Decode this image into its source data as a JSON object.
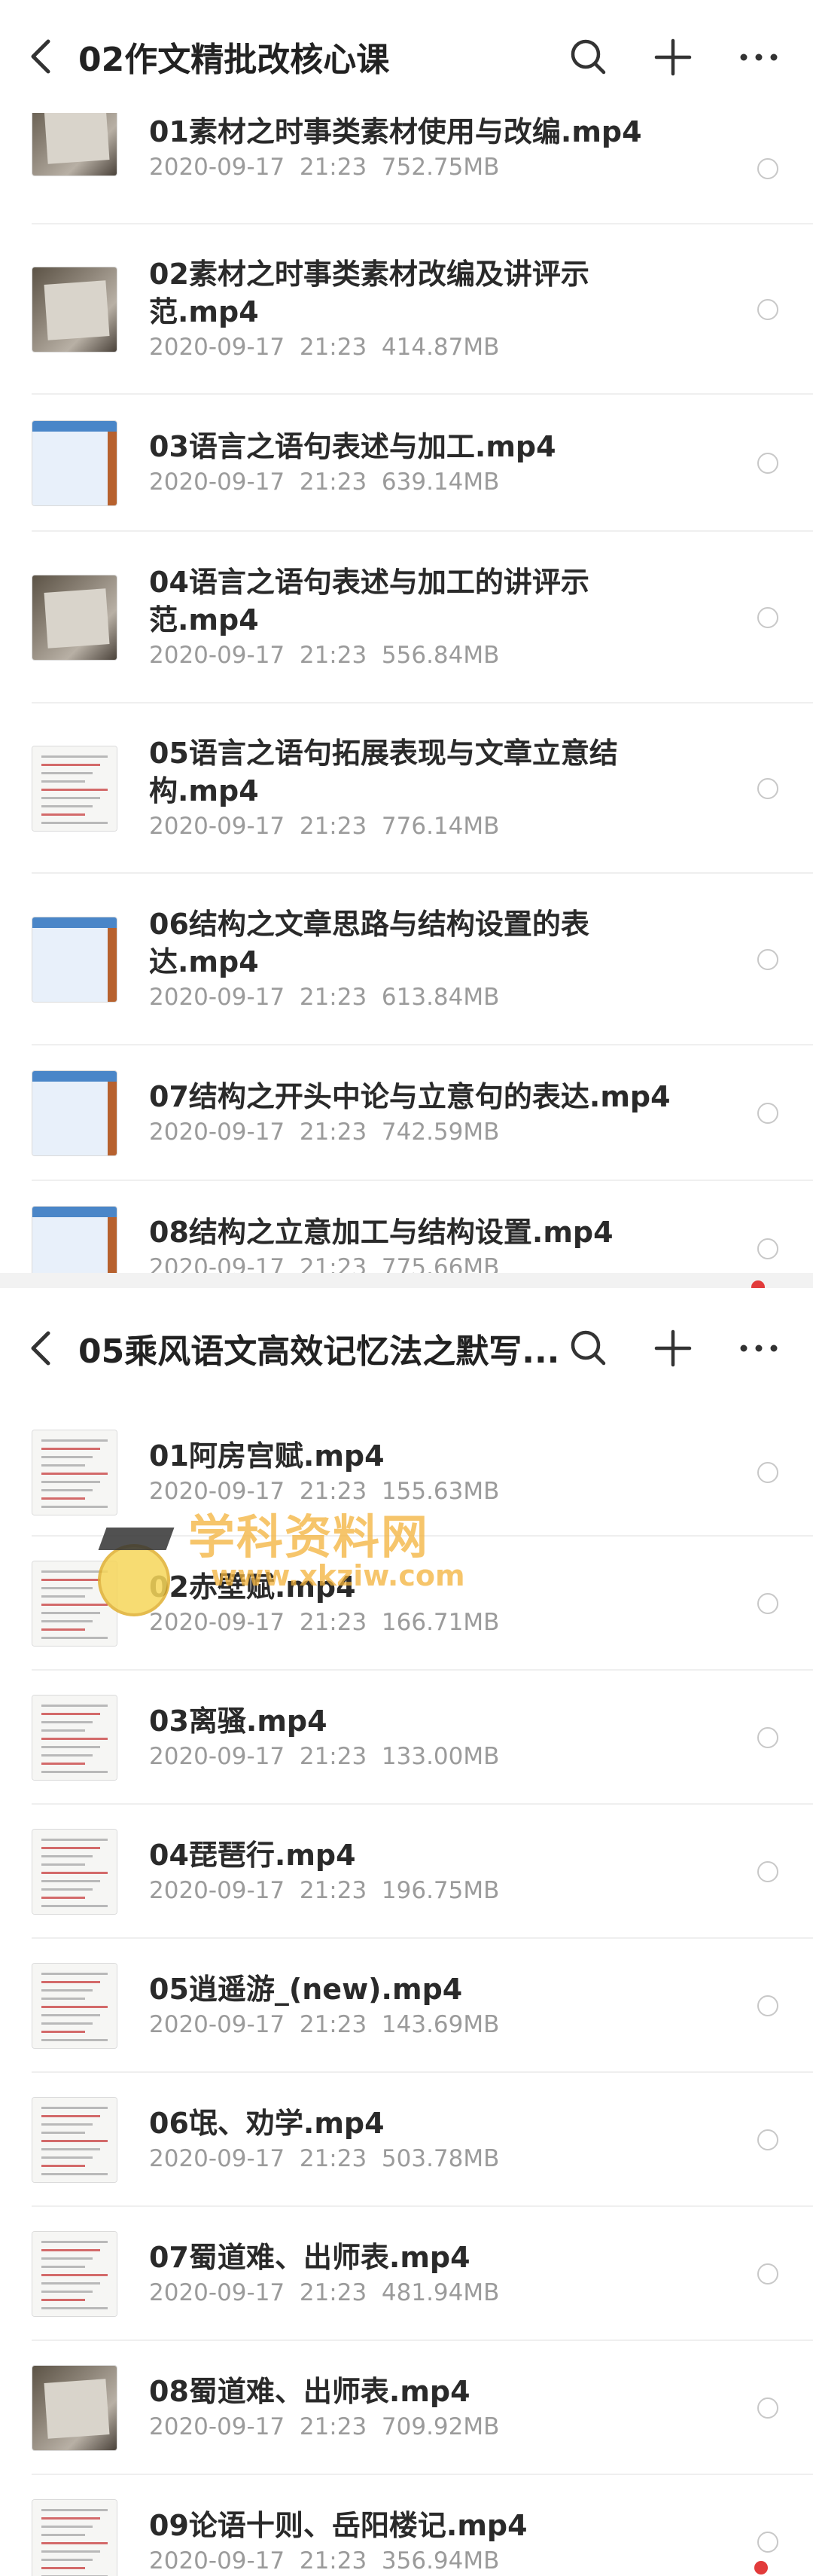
{
  "panel1": {
    "title": "02作文精批改核心课",
    "items": [
      {
        "name": "01素材之时事类素材使用与改编.mp4",
        "meta": "2020-09-17  21:23  752.75MB",
        "thumb": "photo"
      },
      {
        "name": "02素材之时事类素材改编及讲评示范.mp4",
        "meta": "2020-09-17  21:23  414.87MB",
        "thumb": "photo"
      },
      {
        "name": "03语言之语句表述与加工.mp4",
        "meta": "2020-09-17  21:23  639.14MB",
        "thumb": "blue"
      },
      {
        "name": "04语言之语句表述与加工的讲评示范.mp4",
        "meta": "2020-09-17  21:23  556.84MB",
        "thumb": "photo"
      },
      {
        "name": "05语言之语句拓展表现与文章立意结构.mp4",
        "meta": "2020-09-17  21:23  776.14MB",
        "thumb": "doc"
      },
      {
        "name": "06结构之文章思路与结构设置的表达.mp4",
        "meta": "2020-09-17  21:23  613.84MB",
        "thumb": "blue"
      },
      {
        "name": "07结构之开头中论与立意句的表达.mp4",
        "meta": "2020-09-17  21:23  742.59MB",
        "thumb": "blue"
      },
      {
        "name": "08结构之立意加工与结构设置.mp4",
        "meta": "2020-09-17  21:23  775.66MB",
        "thumb": "blue"
      }
    ]
  },
  "panel2": {
    "title": "05乘风语文高效记忆法之默写...",
    "items": [
      {
        "name": "01阿房宫赋.mp4",
        "meta": "2020-09-17  21:23  155.63MB",
        "thumb": "doc"
      },
      {
        "name": "02赤壁赋.mp4",
        "meta": "2020-09-17  21:23  166.71MB",
        "thumb": "doc"
      },
      {
        "name": "03离骚.mp4",
        "meta": "2020-09-17  21:23  133.00MB",
        "thumb": "doc"
      },
      {
        "name": "04琵琶行.mp4",
        "meta": "2020-09-17  21:23  196.75MB",
        "thumb": "doc"
      },
      {
        "name": "05逍遥游_(new).mp4",
        "meta": "2020-09-17  21:23  143.69MB",
        "thumb": "doc"
      },
      {
        "name": "06氓、劝学.mp4",
        "meta": "2020-09-17  21:23  503.78MB",
        "thumb": "doc"
      },
      {
        "name": "07蜀道难、出师表.mp4",
        "meta": "2020-09-17  21:23  481.94MB",
        "thumb": "doc"
      },
      {
        "name": "08蜀道难、出师表.mp4",
        "meta": "2020-09-17  21:23  709.92MB",
        "thumb": "photo"
      },
      {
        "name": "09论语十则、岳阳楼记.mp4",
        "meta": "2020-09-17  21:23  356.94MB",
        "thumb": "doc"
      }
    ]
  },
  "watermark": {
    "line1": "学科资料网",
    "line2": "www.xkziw.com"
  },
  "icons": {
    "back": "back-arrow-icon",
    "search": "search-icon",
    "add": "plus-icon",
    "more": "more-icon"
  },
  "colors": {
    "accent_red": "#e23b3b",
    "watermark": "#f3b23a"
  }
}
